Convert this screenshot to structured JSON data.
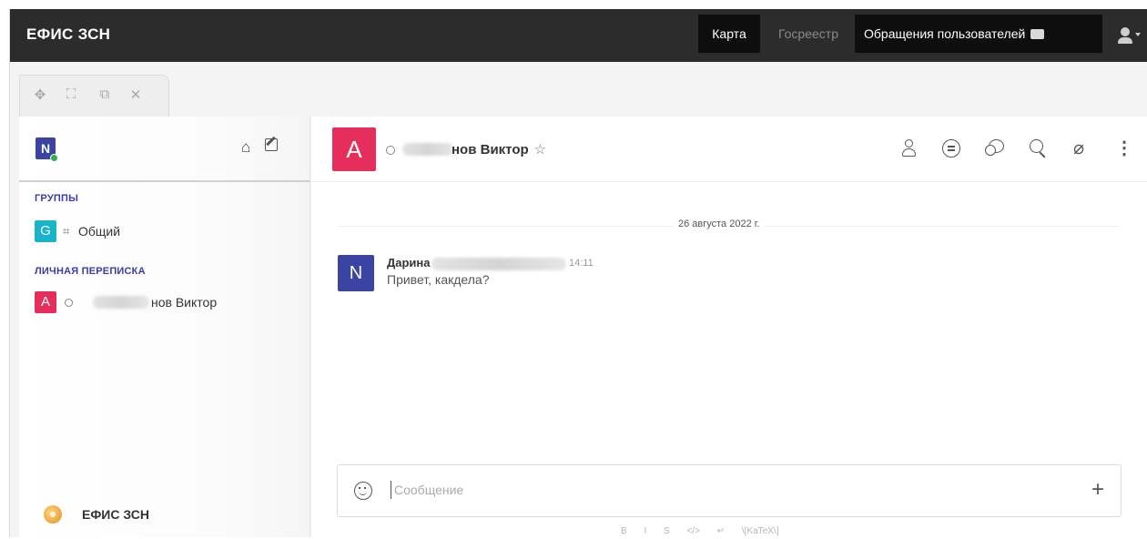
{
  "navbar": {
    "brand": "ЕФИС ЗСН",
    "items": [
      {
        "label": "Карта"
      },
      {
        "label": "Госреестр"
      },
      {
        "label": "Обращения пользователей"
      }
    ]
  },
  "window_tab": {
    "icons": [
      "move-icon",
      "expand-icon",
      "popout-icon",
      "close-icon"
    ],
    "glyphs": [
      "✥",
      "⛶",
      "⧉",
      "✕"
    ]
  },
  "sidebar": {
    "user_avatar_letter": "N",
    "groups_title": "ГРУППЫ",
    "groups": [
      {
        "avatar_letter": "G",
        "avatar_color": "#1bb3c9",
        "prefix": "⌗",
        "name": "Общий"
      }
    ],
    "direct_title": "ЛИЧНАЯ ПЕРЕПИСКА",
    "direct": [
      {
        "avatar_letter": "A",
        "avatar_color": "#e62e5c",
        "name_visible": "нов Виктор"
      }
    ],
    "footer_name": "ЕФИС ЗСН"
  },
  "room": {
    "avatar_letter": "A",
    "avatar_color": "#e62e5c",
    "title_visible": "нов Виктор",
    "star": "☆",
    "header_icons": [
      "user-info-icon",
      "threads-icon",
      "discussion-icon",
      "search-icon",
      "attachment-icon",
      "kebab-menu-icon"
    ]
  },
  "messages": {
    "date_divider": "26 августа 2022 г.",
    "items": [
      {
        "avatar_letter": "N",
        "avatar_color": "#3b44a3",
        "author": "Дарина",
        "time": "14:11",
        "text": "Привет, какдела?"
      }
    ]
  },
  "composer": {
    "placeholder": "Сообщение",
    "plus": "+",
    "format_bar": [
      "B",
      "I",
      "S",
      "</>",
      "↵",
      "\\[KaTeX\\]"
    ]
  },
  "colors": {
    "navbar": "#2c2c2c",
    "accent_purple": "#3c3ca8",
    "online": "#2fb14a"
  }
}
